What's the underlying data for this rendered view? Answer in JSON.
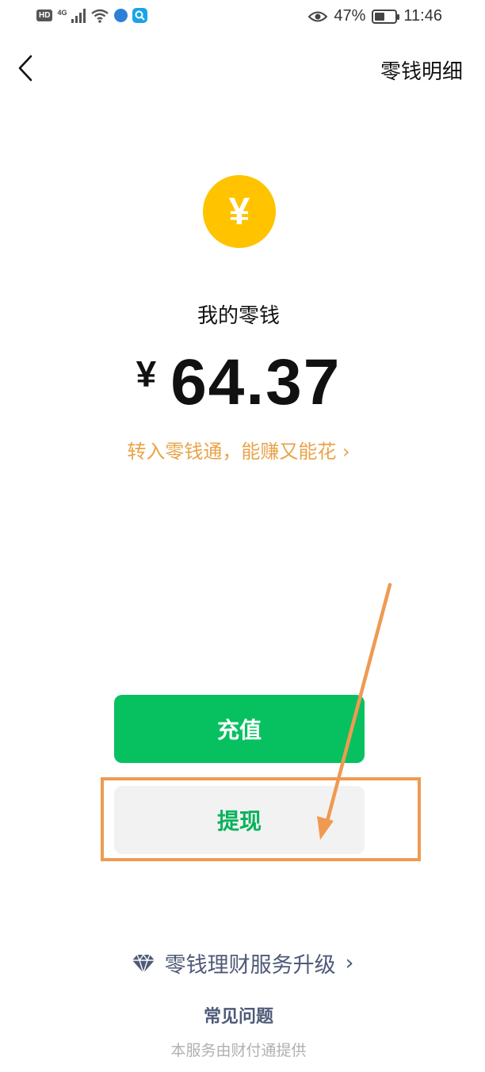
{
  "status_bar": {
    "hd": "HD",
    "network": "4G",
    "battery": "47%",
    "battery_level": 47,
    "time": "11:46"
  },
  "nav": {
    "back_icon": "chevron-left-icon",
    "title": "零钱明细"
  },
  "balance": {
    "coin_symbol": "¥",
    "label": "我的零钱",
    "currency": "¥",
    "amount": "64.37"
  },
  "promo": {
    "text": "转入零钱通，能赚又能花",
    "chevron": "›"
  },
  "actions": {
    "recharge": "充值",
    "withdraw": "提现"
  },
  "footer": {
    "upgrade_icon": "diamond-icon",
    "upgrade": "零钱理财服务升级",
    "upgrade_chevron": "›",
    "faq": "常见问题",
    "provider": "本服务由财付通提供"
  },
  "colors": {
    "primary_green": "#07c160",
    "promo_orange": "#e8a44a",
    "coin_yellow": "#ffc300",
    "annotation_orange": "#ef9a52",
    "link_blue_gray": "#4e5a78"
  }
}
